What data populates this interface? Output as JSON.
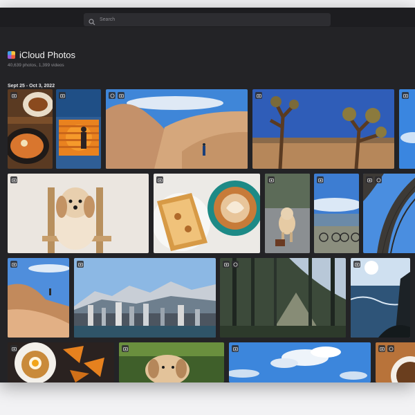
{
  "search": {
    "placeholder": "Search"
  },
  "app": {
    "title": "iCloud Photos",
    "subtitle": "40,639 photos, 1,399 videos"
  },
  "section": {
    "date_range": "Sept 25 - Oct 3, 2022"
  },
  "photos": [
    {
      "name": "food-bowls-photo"
    },
    {
      "name": "orange-art-photo"
    },
    {
      "name": "desert-rocks-photo"
    },
    {
      "name": "joshua-tree-photo"
    },
    {
      "name": "blue-sky-photo"
    },
    {
      "name": "puppy-chair-photo"
    },
    {
      "name": "latte-toast-photo"
    },
    {
      "name": "dog-street-photo"
    },
    {
      "name": "lakeside-bikes-photo"
    },
    {
      "name": "eiffel-tower-photo"
    },
    {
      "name": "desert-hiker-photo"
    },
    {
      "name": "city-mountains-photo"
    },
    {
      "name": "forest-sunbeams-photo"
    },
    {
      "name": "coast-rocks-photo"
    },
    {
      "name": "egg-noodle-dish-photo"
    },
    {
      "name": "dog-grass-photo"
    },
    {
      "name": "clouds-photo"
    },
    {
      "name": "coffee-cup-photo"
    }
  ]
}
